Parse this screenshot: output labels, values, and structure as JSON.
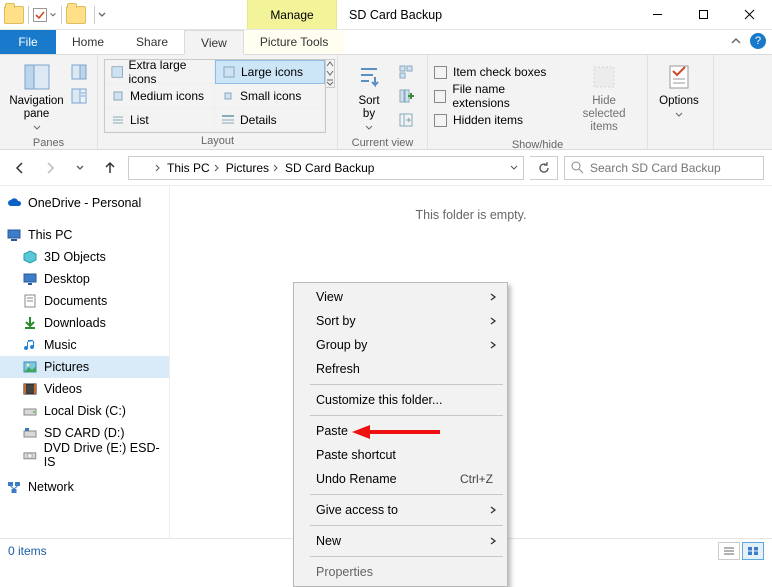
{
  "title": "SD Card Backup",
  "contextual_tab": {
    "header": "Manage",
    "sub": "Picture Tools"
  },
  "tabs": {
    "file": "File",
    "home": "Home",
    "share": "Share",
    "view": "View"
  },
  "ribbon": {
    "panes": {
      "nav_label": "Navigation\npane",
      "group": "Panes"
    },
    "layout": {
      "extra_large": "Extra large icons",
      "large": "Large icons",
      "medium": "Medium icons",
      "small": "Small icons",
      "list": "List",
      "details": "Details",
      "group": "Layout"
    },
    "current_view": {
      "sort_label": "Sort\nby",
      "group": "Current view"
    },
    "show_hide": {
      "item_check": "Item check boxes",
      "filename_ext": "File name extensions",
      "hidden_items": "Hidden items",
      "hide_selected": "Hide selected\nitems",
      "group": "Show/hide"
    },
    "options": "Options"
  },
  "breadcrumbs": [
    "This PC",
    "Pictures",
    "SD Card Backup"
  ],
  "search": {
    "placeholder": "Search SD Card Backup"
  },
  "tree": {
    "onedrive": "OneDrive - Personal",
    "this_pc": "This PC",
    "objects3d": "3D Objects",
    "desktop": "Desktop",
    "documents": "Documents",
    "downloads": "Downloads",
    "music": "Music",
    "pictures": "Pictures",
    "videos": "Videos",
    "local_disk": "Local Disk (C:)",
    "sd_card": "SD CARD (D:)",
    "dvd": "DVD Drive (E:) ESD-IS",
    "network": "Network"
  },
  "content": {
    "empty": "This folder is empty."
  },
  "context_menu": {
    "view": "View",
    "sort_by": "Sort by",
    "group_by": "Group by",
    "refresh": "Refresh",
    "customize": "Customize this folder...",
    "paste": "Paste",
    "paste_shortcut": "Paste shortcut",
    "undo_rename": "Undo Rename",
    "undo_key": "Ctrl+Z",
    "give_access": "Give access to",
    "new": "New",
    "properties": "Properties"
  },
  "status": {
    "items": "0 items"
  }
}
